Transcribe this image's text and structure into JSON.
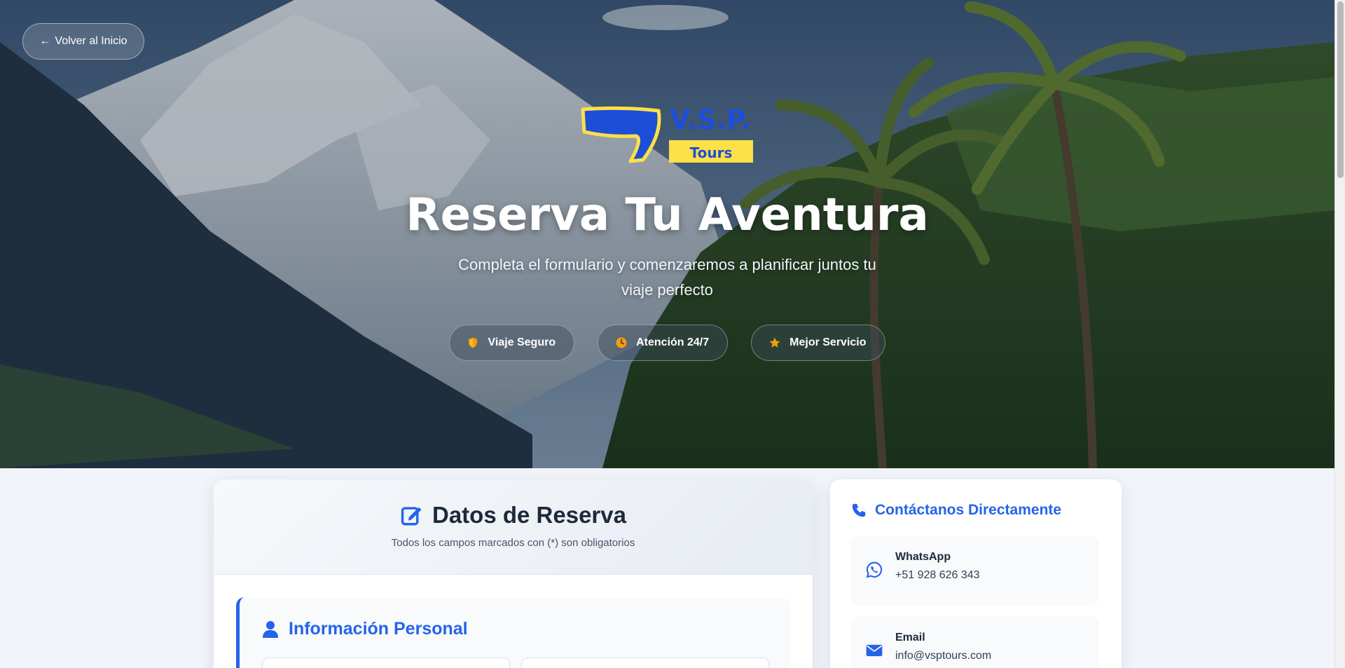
{
  "nav": {
    "back_label": "Volver al Inicio"
  },
  "logo": {
    "text_main": "V.S.P.",
    "text_sub": "Tours"
  },
  "hero": {
    "title": "Reserva Tu Aventura",
    "subtitle": "Completa el formulario y comenzaremos a planificar juntos tu viaje perfecto",
    "badges": [
      {
        "icon": "shield-icon",
        "label": "Viaje Seguro"
      },
      {
        "icon": "clock-icon",
        "label": "Atención 24/7"
      },
      {
        "icon": "star-icon",
        "label": "Mejor Servicio"
      }
    ]
  },
  "form": {
    "title": "Datos de Reserva",
    "subtitle": "Todos los campos marcados con (*) son obligatorios",
    "section_personal": "Información Personal"
  },
  "contact": {
    "title": "Contáctanos Directamente",
    "items": [
      {
        "icon": "whatsapp-icon",
        "label": "WhatsApp",
        "value": "+51 928 626 343"
      },
      {
        "icon": "envelope-icon",
        "label": "Email",
        "value": "info@vsptours.com"
      }
    ]
  },
  "colors": {
    "accent": "#2563eb",
    "badge_icon": "#f59e0b",
    "logo_blue": "#1d4ed8",
    "logo_yellow": "#fde047"
  }
}
